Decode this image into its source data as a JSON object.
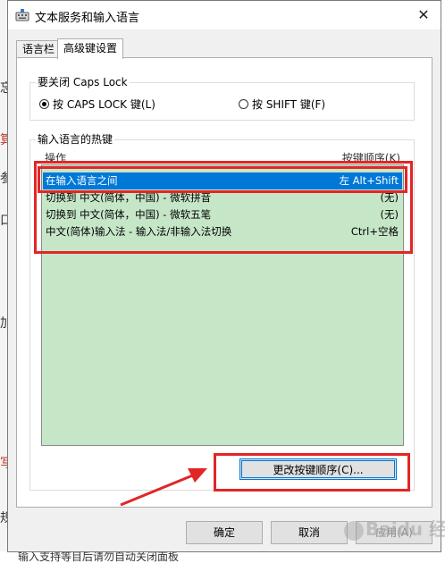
{
  "window": {
    "title": "文本服务和输入语言",
    "close_glyph": "✕"
  },
  "tabs": [
    {
      "label": "语言栏",
      "active": false
    },
    {
      "label": "高级键设置",
      "active": true
    }
  ],
  "caps_group": {
    "title": "要关闭 Caps Lock",
    "options": [
      {
        "label": "按 CAPS LOCK 键(L)",
        "checked": true
      },
      {
        "label": "按 SHIFT 键(F)",
        "checked": false
      }
    ]
  },
  "hotkeys_group": {
    "title": "输入语言的热键",
    "col_action": "操作",
    "col_keys": "按键顺序(K)",
    "rows": [
      {
        "action": "在输入语言之间",
        "keys": "左 Alt+Shift",
        "selected": true
      },
      {
        "action": "切换到 中文(简体，中国) - 微软拼音",
        "keys": "(无)",
        "selected": false
      },
      {
        "action": "切换到 中文(简体，中国) - 微软五笔",
        "keys": "(无)",
        "selected": false
      },
      {
        "action": "中文(简体)输入法 - 输入法/非输入法切换",
        "keys": "Ctrl+空格",
        "selected": false
      }
    ],
    "list_bg": "#c6e6c8",
    "selection_color": "#0078d7"
  },
  "buttons": {
    "change_key_sequence": "更改按键顺序(C)...",
    "ok": "确定",
    "cancel": "取消",
    "apply": "应用(A)"
  },
  "annotation_color": "#e32526",
  "watermark": "Baidu 经验",
  "background_page": {
    "bottom_text": "输入支持等目后请勿自动关闭面板"
  }
}
